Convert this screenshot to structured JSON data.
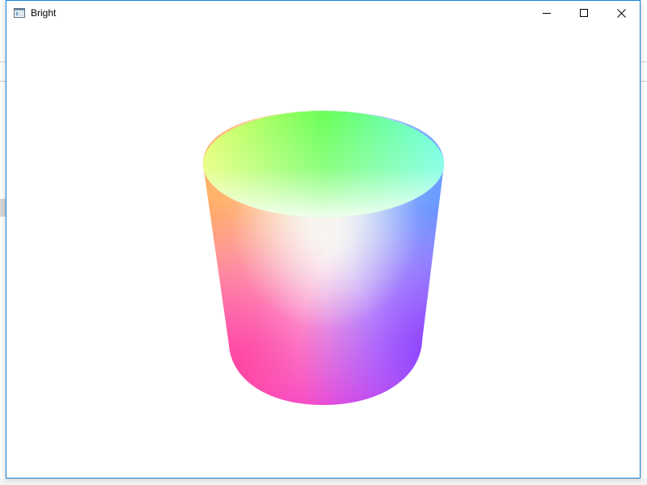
{
  "window": {
    "title": "Bright",
    "icon": "window-app-icon",
    "controls": {
      "minimize": "minimize-icon",
      "maximize": "maximize-icon",
      "close": "close-icon"
    }
  },
  "scene": {
    "object": "cylinder",
    "colors": {
      "top_left": "#e6ff66",
      "top_center": "#66ff55",
      "top_right": "#66ffe6",
      "middle_center": "#f4f4f0",
      "right_side": "#6699ff",
      "bottom_left": "#ff44a0",
      "bottom_right": "#8a40ff",
      "bottom_center": "#ee44e6",
      "left_side": "#ffb066"
    }
  },
  "colors": {
    "window_border": "#1883d7",
    "background": "#ffffff"
  }
}
